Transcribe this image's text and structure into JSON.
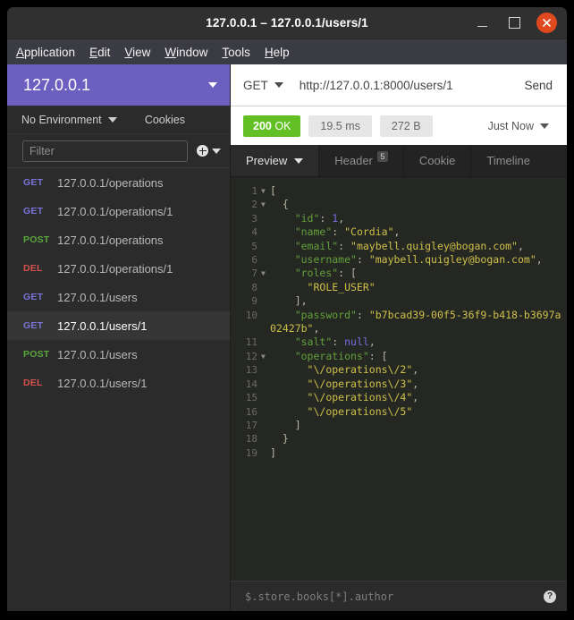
{
  "window": {
    "title": "127.0.0.1 – 127.0.0.1/users/1",
    "controls": {
      "minimize": "–",
      "maximize": "□",
      "close": "×"
    }
  },
  "menubar": {
    "items": [
      {
        "label": "Application",
        "mnemonic": "A"
      },
      {
        "label": "Edit",
        "mnemonic": "E"
      },
      {
        "label": "View",
        "mnemonic": "V"
      },
      {
        "label": "Window",
        "mnemonic": "W"
      },
      {
        "label": "Tools",
        "mnemonic": "T"
      },
      {
        "label": "Help",
        "mnemonic": "H"
      }
    ]
  },
  "sidebar": {
    "workspace": "127.0.0.1",
    "environment": "No Environment",
    "cookies_label": "Cookies",
    "filter_placeholder": "Filter",
    "requests": [
      {
        "method": "GET",
        "url": "127.0.0.1/operations",
        "selected": false
      },
      {
        "method": "GET",
        "url": "127.0.0.1/operations/1",
        "selected": false
      },
      {
        "method": "POST",
        "url": "127.0.0.1/operations",
        "selected": false
      },
      {
        "method": "DEL",
        "url": "127.0.0.1/operations/1",
        "selected": false
      },
      {
        "method": "GET",
        "url": "127.0.0.1/users",
        "selected": false
      },
      {
        "method": "GET",
        "url": "127.0.0.1/users/1",
        "selected": true
      },
      {
        "method": "POST",
        "url": "127.0.0.1/users",
        "selected": false
      },
      {
        "method": "DEL",
        "url": "127.0.0.1/users/1",
        "selected": false
      }
    ],
    "method_colors": {
      "GET": "#7b74d8",
      "POST": "#5aa83c",
      "DEL": "#d8534f"
    }
  },
  "request_bar": {
    "method": "GET",
    "url": "http://127.0.0.1:8000/users/1",
    "send_label": "Send"
  },
  "response_status": {
    "code": "200",
    "code_text": "OK",
    "time": "19.5 ms",
    "size": "272 B",
    "timeago": "Just Now",
    "status_color": "#63c024"
  },
  "tabs": [
    {
      "label": "Preview",
      "active": true,
      "badge": null,
      "has_caret": true
    },
    {
      "label": "Header",
      "active": false,
      "badge": "5",
      "has_caret": false
    },
    {
      "label": "Cookie",
      "active": false,
      "badge": null,
      "has_caret": false
    },
    {
      "label": "Timeline",
      "active": false,
      "badge": null,
      "has_caret": false
    }
  ],
  "response_body": {
    "lines": [
      {
        "num": "1",
        "fold": true,
        "tokens": [
          {
            "t": "[",
            "c": "p"
          }
        ]
      },
      {
        "num": "2",
        "fold": true,
        "tokens": [
          {
            "t": "  {",
            "c": "p"
          }
        ]
      },
      {
        "num": "3",
        "fold": false,
        "tokens": [
          {
            "t": "    ",
            "c": "p"
          },
          {
            "t": "\"id\"",
            "c": "k"
          },
          {
            "t": ": ",
            "c": "p"
          },
          {
            "t": "1",
            "c": "n"
          },
          {
            "t": ",",
            "c": "p"
          }
        ]
      },
      {
        "num": "4",
        "fold": false,
        "tokens": [
          {
            "t": "    ",
            "c": "p"
          },
          {
            "t": "\"name\"",
            "c": "k"
          },
          {
            "t": ": ",
            "c": "p"
          },
          {
            "t": "\"Cordia\"",
            "c": "s"
          },
          {
            "t": ",",
            "c": "p"
          }
        ]
      },
      {
        "num": "5",
        "fold": false,
        "tokens": [
          {
            "t": "    ",
            "c": "p"
          },
          {
            "t": "\"email\"",
            "c": "k"
          },
          {
            "t": ": ",
            "c": "p"
          },
          {
            "t": "\"maybell.quigley@bogan.com\"",
            "c": "s"
          },
          {
            "t": ",",
            "c": "p"
          }
        ]
      },
      {
        "num": "6",
        "fold": false,
        "tokens": [
          {
            "t": "    ",
            "c": "p"
          },
          {
            "t": "\"username\"",
            "c": "k"
          },
          {
            "t": ": ",
            "c": "p"
          },
          {
            "t": "\"maybell.quigley@bogan.com\"",
            "c": "s"
          },
          {
            "t": ",",
            "c": "p"
          }
        ]
      },
      {
        "num": "7",
        "fold": true,
        "tokens": [
          {
            "t": "    ",
            "c": "p"
          },
          {
            "t": "\"roles\"",
            "c": "k"
          },
          {
            "t": ": [",
            "c": "p"
          }
        ]
      },
      {
        "num": "8",
        "fold": false,
        "tokens": [
          {
            "t": "      ",
            "c": "p"
          },
          {
            "t": "\"ROLE_USER\"",
            "c": "s"
          }
        ]
      },
      {
        "num": "9",
        "fold": false,
        "tokens": [
          {
            "t": "    ],",
            "c": "p"
          }
        ]
      },
      {
        "num": "10",
        "fold": false,
        "tokens": [
          {
            "t": "    ",
            "c": "p"
          },
          {
            "t": "\"password\"",
            "c": "k"
          },
          {
            "t": ": ",
            "c": "p"
          },
          {
            "t": "\"b7bcad39-00f5-36f9-b418-b3697a02427b\"",
            "c": "s"
          },
          {
            "t": ",",
            "c": "p"
          }
        ]
      },
      {
        "num": "11",
        "fold": false,
        "tokens": [
          {
            "t": "    ",
            "c": "p"
          },
          {
            "t": "\"salt\"",
            "c": "k"
          },
          {
            "t": ": ",
            "c": "p"
          },
          {
            "t": "null",
            "c": "n"
          },
          {
            "t": ",",
            "c": "p"
          }
        ]
      },
      {
        "num": "12",
        "fold": true,
        "tokens": [
          {
            "t": "    ",
            "c": "p"
          },
          {
            "t": "\"operations\"",
            "c": "k"
          },
          {
            "t": ": [",
            "c": "p"
          }
        ]
      },
      {
        "num": "13",
        "fold": false,
        "tokens": [
          {
            "t": "      ",
            "c": "p"
          },
          {
            "t": "\"\\/operations\\/2\"",
            "c": "s"
          },
          {
            "t": ",",
            "c": "p"
          }
        ]
      },
      {
        "num": "14",
        "fold": false,
        "tokens": [
          {
            "t": "      ",
            "c": "p"
          },
          {
            "t": "\"\\/operations\\/3\"",
            "c": "s"
          },
          {
            "t": ",",
            "c": "p"
          }
        ]
      },
      {
        "num": "15",
        "fold": false,
        "tokens": [
          {
            "t": "      ",
            "c": "p"
          },
          {
            "t": "\"\\/operations\\/4\"",
            "c": "s"
          },
          {
            "t": ",",
            "c": "p"
          }
        ]
      },
      {
        "num": "16",
        "fold": false,
        "tokens": [
          {
            "t": "      ",
            "c": "p"
          },
          {
            "t": "\"\\/operations\\/5\"",
            "c": "s"
          }
        ]
      },
      {
        "num": "17",
        "fold": false,
        "tokens": [
          {
            "t": "    ]",
            "c": "p"
          }
        ]
      },
      {
        "num": "18",
        "fold": false,
        "tokens": [
          {
            "t": "  }",
            "c": "p"
          }
        ]
      },
      {
        "num": "19",
        "fold": false,
        "tokens": [
          {
            "t": "]",
            "c": "p"
          }
        ]
      }
    ]
  },
  "jsonpath": {
    "placeholder": "$.store.books[*].author",
    "value": "",
    "help_glyph": "?"
  }
}
